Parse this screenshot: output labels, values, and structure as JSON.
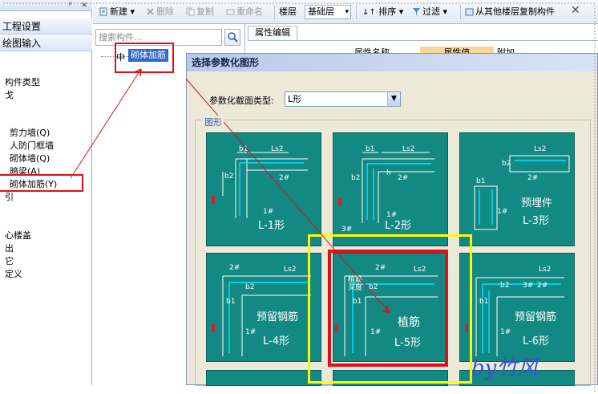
{
  "left_panel": {
    "header_pin": "ᵖ",
    "header_close": "×",
    "nav_items": [
      "工程设置",
      "绘图输入"
    ],
    "tree_title": "构件类型",
    "tree_items": [
      "剪力墙(Q)",
      "人防门框墙",
      "砌体墙(Q)",
      "暗梁(A)",
      "砌体加筋(Y)"
    ],
    "tree_partial": [
      "戈",
      "引",
      "心楼盖",
      "出",
      "它",
      "定义"
    ]
  },
  "toolbar": {
    "new_label": "新建",
    "delete_label": "删除",
    "copy_label": "复制",
    "rename_label": "重命名",
    "floor_label": "楼层",
    "floor_value": "基础层",
    "sort_label": "排序",
    "filter_label": "过滤",
    "copy_floor_label": "从其他楼层复制构件"
  },
  "component_panel": {
    "search_placeholder": "搜索构件...",
    "selected_item": "砌体加筋"
  },
  "property_panel": {
    "tab_label": "属性编辑",
    "col_name": "属性名称",
    "col_value": "属性值",
    "col_extra": "附加"
  },
  "dialog": {
    "title": "选择参数化图形",
    "type_label": "参数化截面类型:",
    "type_value": "L形",
    "group_label": "图形",
    "cards": [
      {
        "caption": "L-1形"
      },
      {
        "caption": "L-2形"
      },
      {
        "caption": "L-3形",
        "subtitle": "预埋件"
      },
      {
        "caption": "L-4形",
        "subtitle": "预留钢筋"
      },
      {
        "caption": "L-5形",
        "subtitle": "植筋",
        "depth": "植筋\n深度"
      },
      {
        "caption": "L-6形",
        "subtitle": "预留钢筋"
      }
    ],
    "dim_labels": {
      "b1": "b1",
      "b2": "b2",
      "ls2": "Ls2",
      "r1": "1#",
      "r2": "2#",
      "r3": "3#",
      "h": "h",
      "b": "b"
    }
  },
  "watermark": "by竹风",
  "colors": {
    "card_bg": "#138984",
    "highlight_red": "#e0101a",
    "highlight_yellow": "#ffff00",
    "wm_blue": "#3b4fd6"
  }
}
